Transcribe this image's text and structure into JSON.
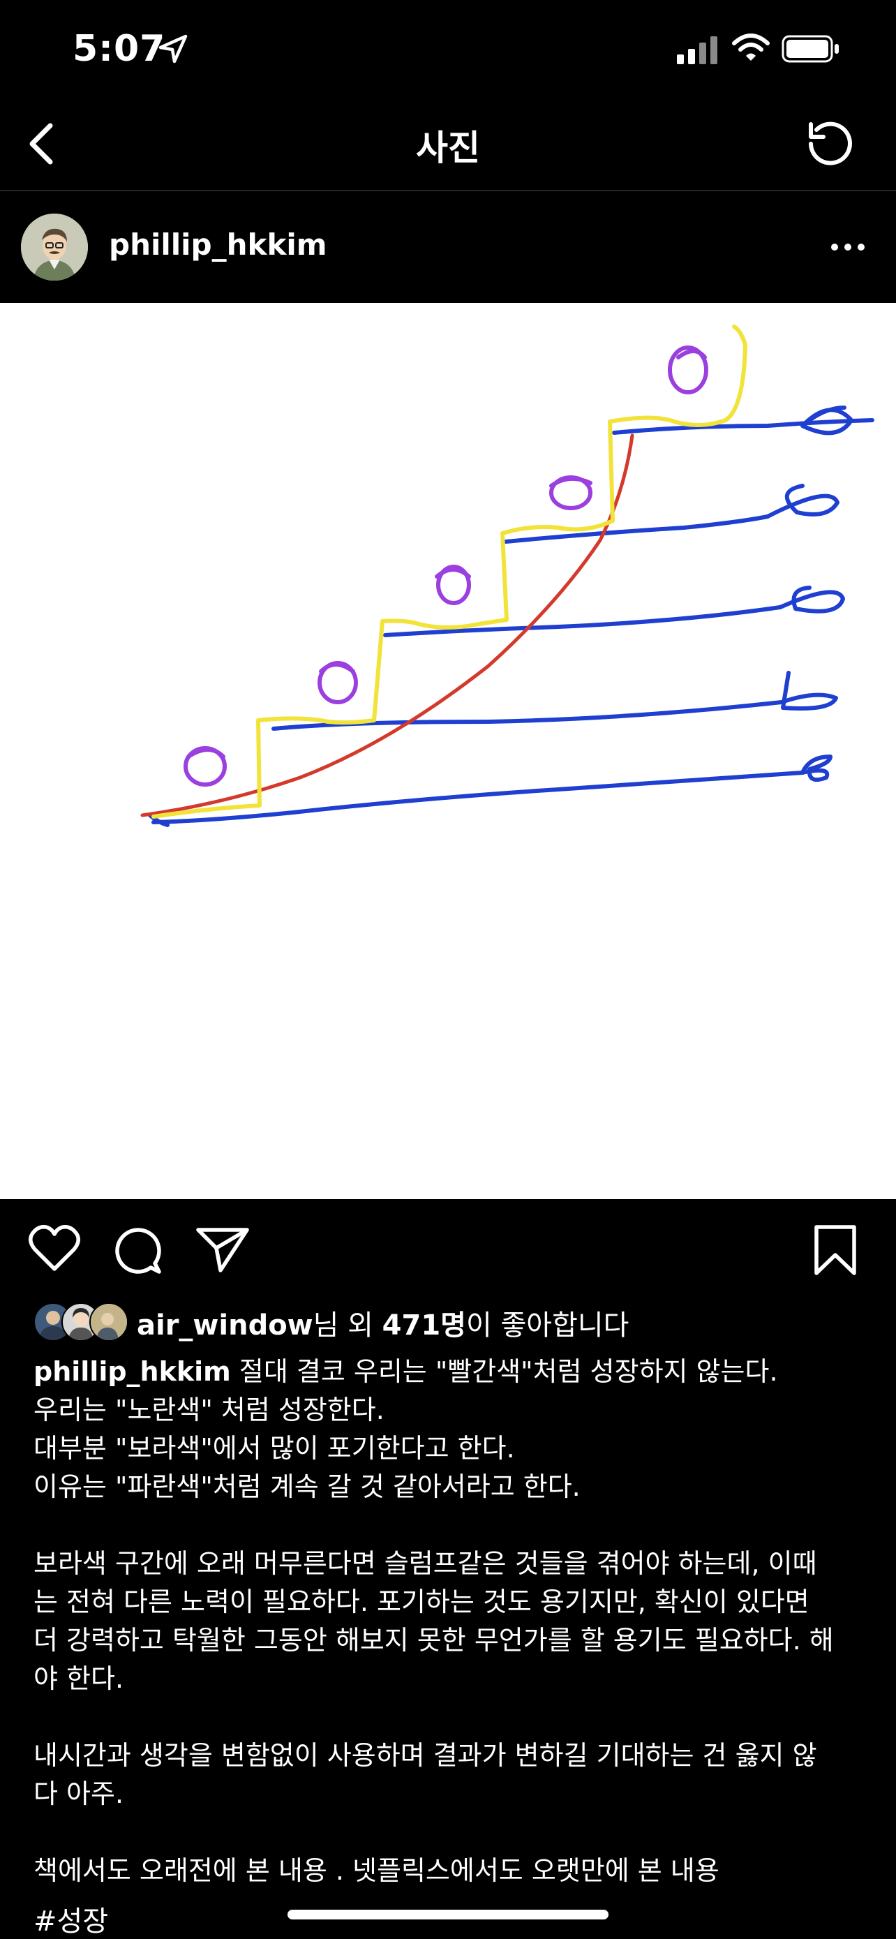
{
  "status_bar": {
    "time": "5:07"
  },
  "nav": {
    "title": "사진"
  },
  "post": {
    "username": "phillip_hkkim",
    "likes": {
      "prefix_user": "air_window",
      "middle": "님 외 ",
      "count": "471명",
      "suffix": "이 좋아합니다"
    },
    "caption": {
      "username": "phillip_hkkim",
      "text": " 절대 결코 우리는 \"빨간색\"처럼 성장하지 않는다.\n우리는 \"노란색\" 처럼 성장한다.\n대부분 \"보라색\"에서 많이 포기한다고 한다.\n이유는 \"파란색\"처럼 계속 갈 것 같아서라고 한다.\n\n보라색 구간에 오래 머무른다면 슬럼프같은 것들을 겪어야 하는데, 이때\n는 전혀 다른 노력이 필요하다. 포기하는 것도 용기지만, 확신이 있다면\n더 강력하고 탁월한 그동안 해보지 못한 무언가를 할 용기도 필요하다. 해\n야 한다.\n\n내시간과 생각을 변함없이 사용하며 결과가 변하길 기대하는 건 옳지 않\n다 아주.\n\n책에서도 오래전에 본 내용 . 넷플릭스에서도 오랫만에 본 내용"
    },
    "hashtag": "#성장"
  },
  "drawing_colors": {
    "red": "#d33a2c",
    "yellow": "#f2e33a",
    "purple": "#9b3fe0",
    "blue": "#1f3fd1"
  }
}
